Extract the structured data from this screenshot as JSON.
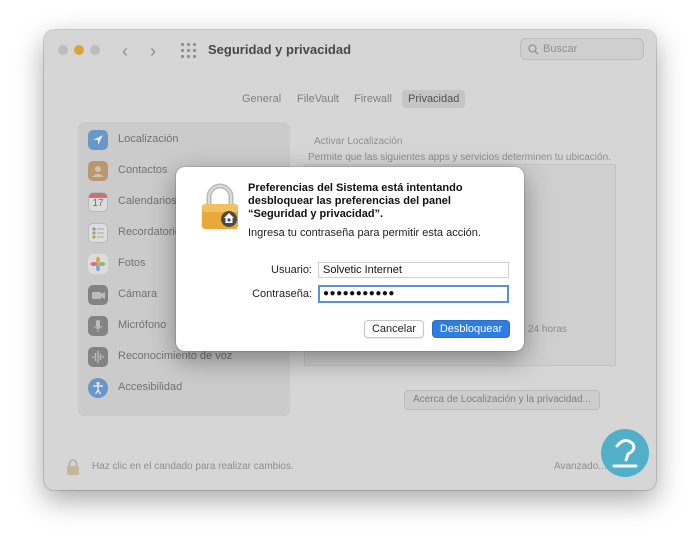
{
  "window": {
    "title": "Seguridad y privacidad"
  },
  "search": {
    "placeholder": "Buscar"
  },
  "tabs": [
    {
      "label": "General"
    },
    {
      "label": "FileVault"
    },
    {
      "label": "Firewall"
    },
    {
      "label": "Privacidad",
      "selected": true
    }
  ],
  "sidebar": {
    "items": [
      {
        "label": "Localización",
        "icon": "location-icon"
      },
      {
        "label": "Contactos",
        "icon": "contacts-icon"
      },
      {
        "label": "Calendarios",
        "icon": "calendar-icon",
        "day": "17"
      },
      {
        "label": "Recordatorios",
        "icon": "reminders-icon"
      },
      {
        "label": "Fotos",
        "icon": "photos-icon"
      },
      {
        "label": "Cámara",
        "icon": "camera-icon"
      },
      {
        "label": "Micrófono",
        "icon": "microphone-icon"
      },
      {
        "label": "Reconocimiento de voz",
        "icon": "speech-recognition-icon"
      },
      {
        "label": "Accesibilidad",
        "icon": "accessibility-icon"
      }
    ]
  },
  "right": {
    "enable_label": "Activar Localización",
    "description": "Permite que las siguientes apps y servicios determinen tu ubicación.",
    "hours_note": "24 horas",
    "about_button": "Acerca de Localización y la privacidad..."
  },
  "bottom": {
    "lock_text": "Haz clic en el candado para realizar cambios.",
    "advanced_label": "Avanzado..."
  },
  "dialog": {
    "title": "Preferencias del Sistema está intentando desbloquear las preferencias del panel “Seguridad y privacidad”.",
    "subtitle": "Ingresa tu contraseña para permitir esta acción.",
    "username_label": "Usuario:",
    "username_value": "Solvetic Internet",
    "password_label": "Contraseña:",
    "password_value": "●●●●●●●●●●●",
    "cancel_label": "Cancelar",
    "unlock_label": "Desbloquear"
  },
  "colors": {
    "accent": "#2e7de0",
    "lock_gold": "#e8a83a",
    "traffic_close": "#d8d8d8",
    "traffic_min": "#f2b33c",
    "watermark": "#3aa8c4"
  }
}
